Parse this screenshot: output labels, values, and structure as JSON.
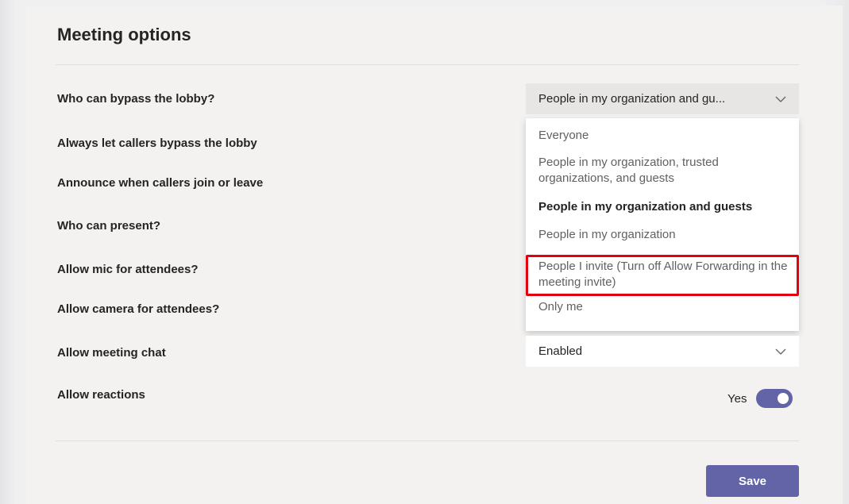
{
  "page": {
    "title": "Meeting options"
  },
  "options": [
    {
      "label": "Who can bypass the lobby?"
    },
    {
      "label": "Always let callers bypass the lobby"
    },
    {
      "label": "Announce when callers join or leave"
    },
    {
      "label": "Who can present?"
    },
    {
      "label": "Allow mic for attendees?"
    },
    {
      "label": "Allow camera for attendees?"
    },
    {
      "label": "Allow meeting chat"
    },
    {
      "label": "Allow reactions"
    }
  ],
  "lobby_select": {
    "value": "People in my organization and gu...",
    "icon": "chevron-down-icon"
  },
  "lobby_dropdown": {
    "items": [
      "Everyone",
      "People in my organization, trusted organizations, and guests",
      "People in my organization and guests",
      "People in my organization",
      "People I invite (Turn off Allow Forwarding in the meeting invite)",
      "Only me"
    ],
    "selected_index": 2,
    "highlighted_index": 4,
    "highlight_color": "#e3000f"
  },
  "chat_select": {
    "value": "Enabled",
    "icon": "chevron-down-icon"
  },
  "reactions_toggle": {
    "label": "Yes",
    "on": true
  },
  "save_button": {
    "label": "Save"
  },
  "colors": {
    "accent": "#6264a7",
    "panel_bg": "#f3f2f1",
    "text": "#252423"
  }
}
